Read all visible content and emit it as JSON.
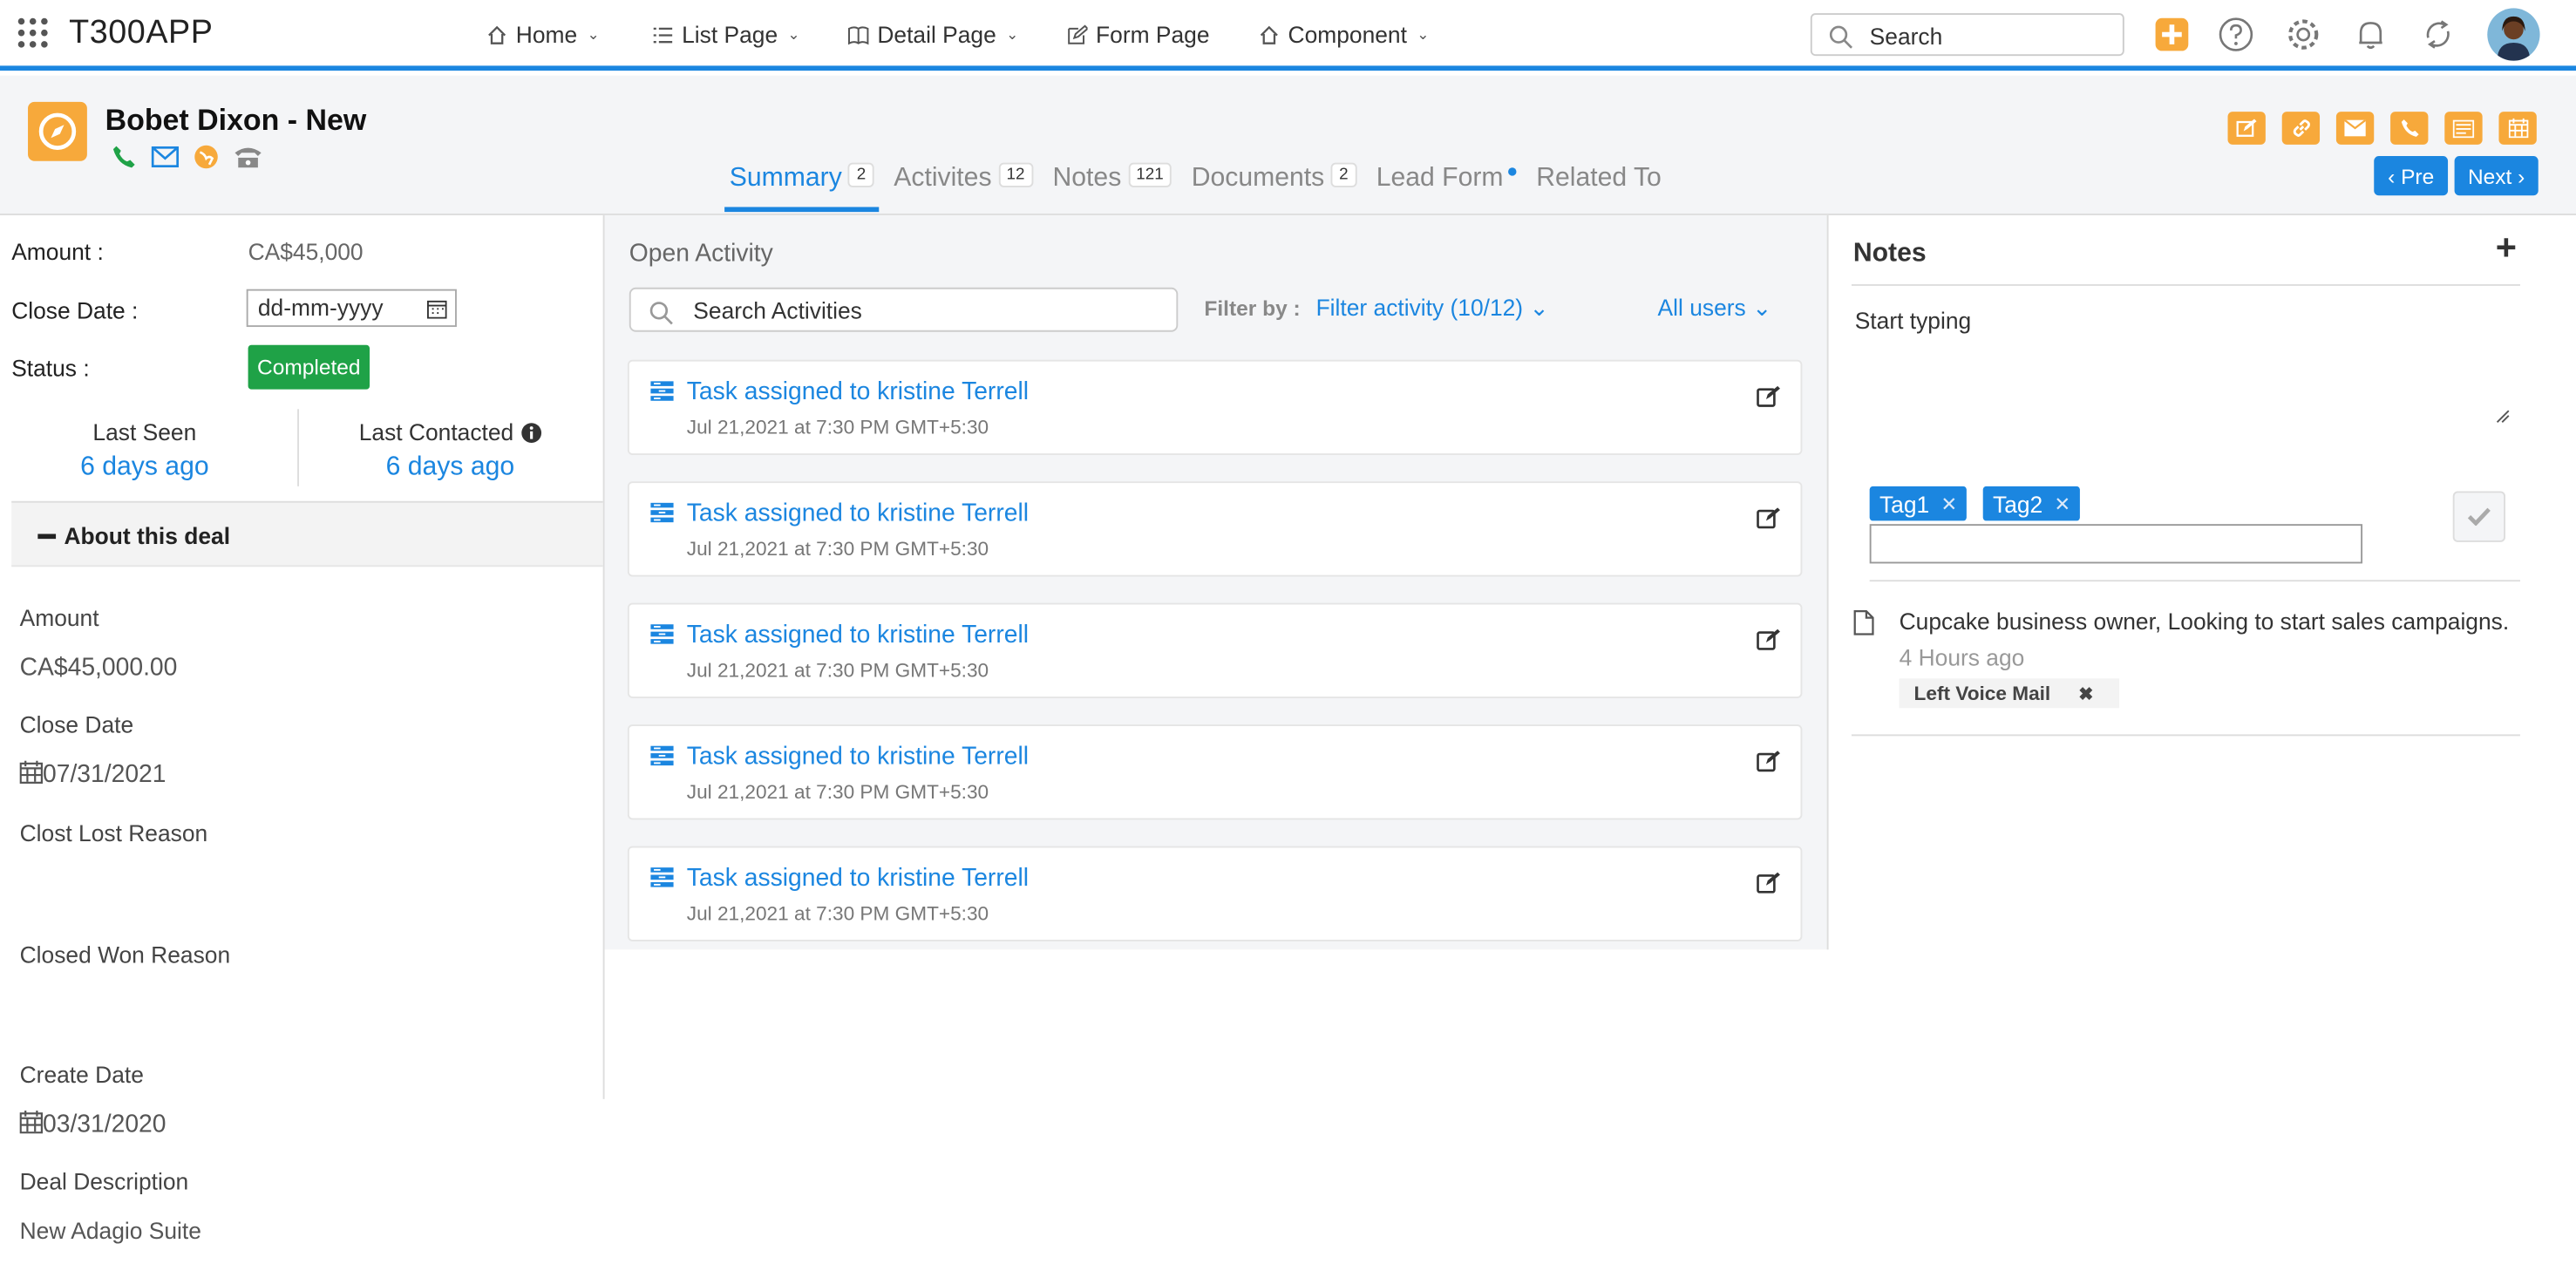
{
  "app": {
    "brand": "T300APP"
  },
  "nav": [
    {
      "label": "Home",
      "icon": "home-icon"
    },
    {
      "label": "List Page",
      "icon": "list-icon"
    },
    {
      "label": "Detail Page",
      "icon": "book-icon"
    },
    {
      "label": "Form Page",
      "icon": "edit-icon"
    },
    {
      "label": "Component",
      "icon": "home-icon"
    }
  ],
  "search": {
    "placeholder": "Search"
  },
  "record": {
    "title": "Bobet Dixon - New",
    "tabs": [
      {
        "label": "Summary",
        "count": "2"
      },
      {
        "label": "Activites",
        "count": "12"
      },
      {
        "label": "Notes",
        "count": "121"
      },
      {
        "label": "Documents",
        "count": "2"
      },
      {
        "label": "Lead Form"
      },
      {
        "label": "Related To"
      }
    ],
    "prev_label": "Pre",
    "next_label": "Next"
  },
  "summary": {
    "amount_label": "Amount :",
    "amount_value": "CA$45,000",
    "close_date_label": "Close Date :",
    "close_date_placeholder": "dd-mm-yyyy",
    "status_label": "Status :",
    "status_value": "Completed",
    "last_seen_label": "Last Seen",
    "last_seen_value": "6 days ago",
    "last_contacted_label": "Last Contacted",
    "last_contacted_value": "6 days ago",
    "about_label": "About this deal",
    "fields": [
      {
        "label": "Amount",
        "value": "CA$45,000.00"
      },
      {
        "label": "Close Date",
        "value": "07/31/2021"
      },
      {
        "label": "Clost Lost Reason",
        "value": ""
      },
      {
        "label": "Closed Won Reason",
        "value": ""
      },
      {
        "label": "Create Date",
        "value": "03/31/2020"
      },
      {
        "label": "Deal Description",
        "value": "New Adagio Suite"
      }
    ]
  },
  "activity": {
    "heading": "Open Activity",
    "search_placeholder": "Search Activities",
    "filter_by_label": "Filter by :",
    "filter_value": "Filter activity (10/12)",
    "users_value": "All users",
    "items": [
      {
        "title": "Task assigned to kristine Terrell",
        "date": "Jul 21,2021 at 7:30 PM GMT+5:30"
      },
      {
        "title": "Task assigned to kristine Terrell",
        "date": "Jul 21,2021 at 7:30 PM GMT+5:30"
      },
      {
        "title": "Task assigned to kristine Terrell",
        "date": "Jul 21,2021 at 7:30 PM GMT+5:30"
      },
      {
        "title": "Task assigned to kristine Terrell",
        "date": "Jul 21,2021 at 7:30 PM GMT+5:30"
      },
      {
        "title": "Task assigned to kristine Terrell",
        "date": "Jul 21,2021 at 7:30 PM GMT+5:30"
      }
    ]
  },
  "notes": {
    "heading": "Notes",
    "add_label": "+",
    "editor_placeholder": "Start typing",
    "tags": [
      "Tag1",
      "Tag2"
    ],
    "items": [
      {
        "text": "Cupcake business owner, Looking to start sales campaigns.",
        "time": "4 Hours ago",
        "label": "Left Voice Mail"
      }
    ]
  },
  "colors": {
    "accent": "#1b86e0",
    "orange": "#f7a93b",
    "success": "#1fa247"
  }
}
